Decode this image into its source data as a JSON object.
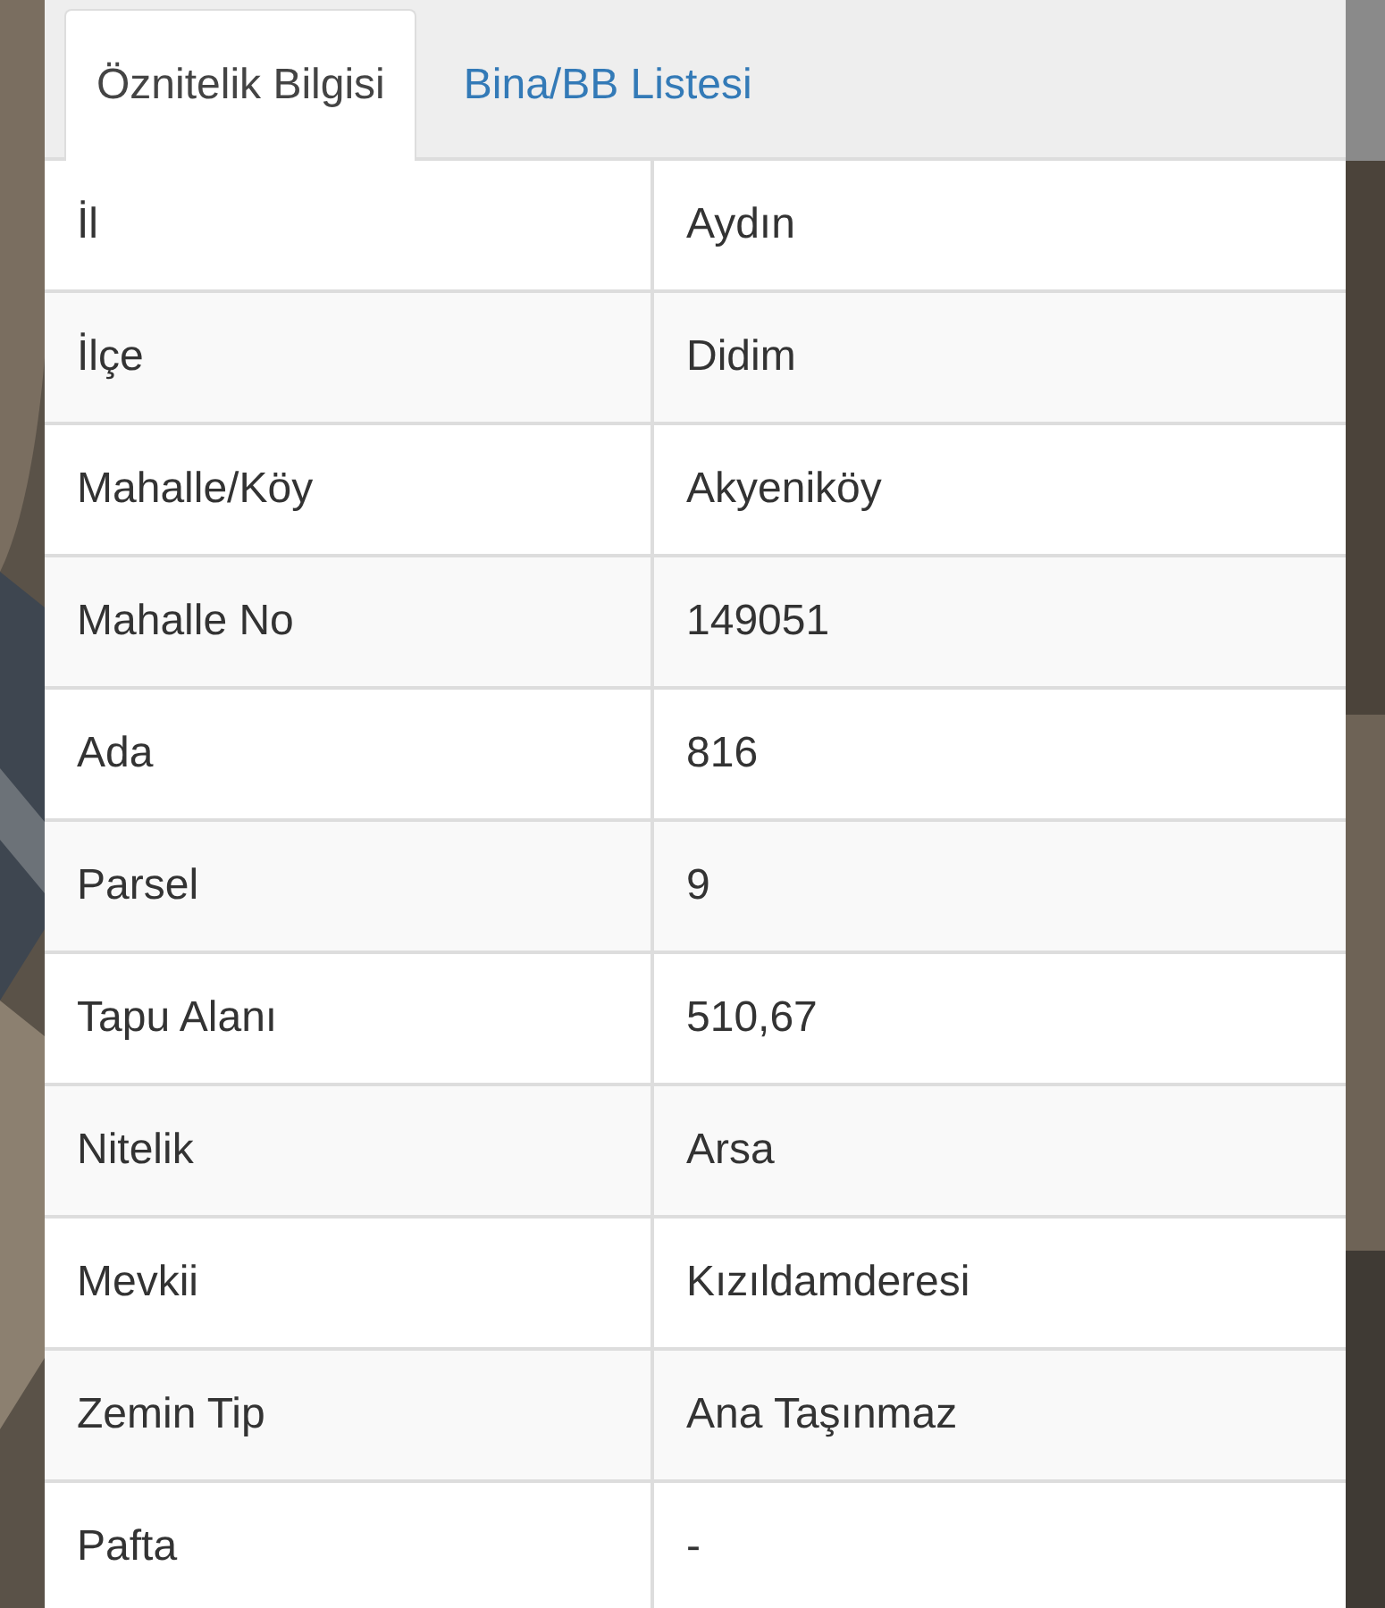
{
  "tabs": [
    {
      "label": "Öznitelik Bilgisi",
      "selected": true
    },
    {
      "label": "Bina/BB Listesi",
      "selected": false
    }
  ],
  "table": {
    "rows": [
      {
        "label": "İl",
        "value": "Aydın"
      },
      {
        "label": "İlçe",
        "value": "Didim"
      },
      {
        "label": "Mahalle/Köy",
        "value": "Akyeniköy"
      },
      {
        "label": "Mahalle No",
        "value": "149051"
      },
      {
        "label": "Ada",
        "value": "816"
      },
      {
        "label": "Parsel",
        "value": "9"
      },
      {
        "label": "Tapu Alanı",
        "value": "510,67"
      },
      {
        "label": "Nitelik",
        "value": "Arsa"
      },
      {
        "label": "Mevkii",
        "value": "Kızıldamderesi"
      },
      {
        "label": "Zemin Tip",
        "value": "Ana Taşınmaz"
      },
      {
        "label": "Pafta",
        "value": "-"
      }
    ]
  }
}
